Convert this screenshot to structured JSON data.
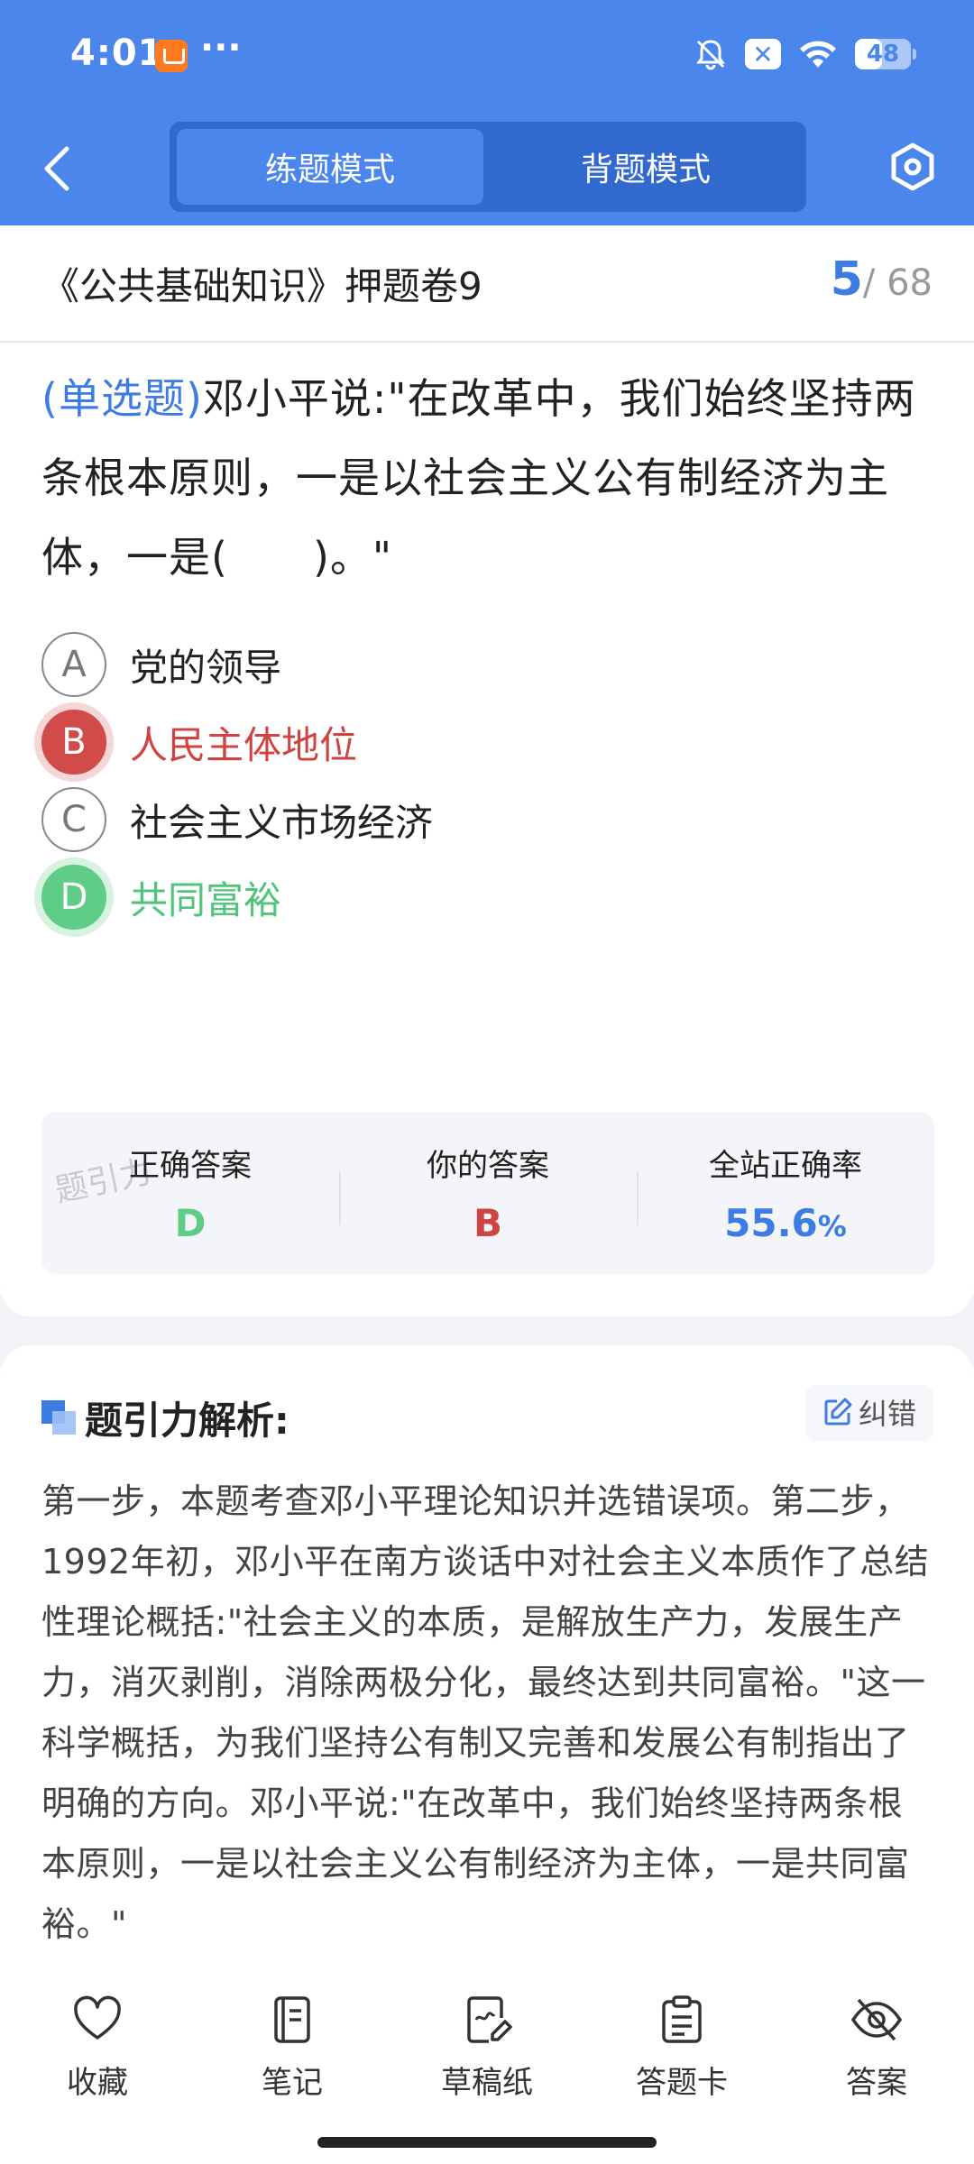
{
  "status_bar": {
    "time": "4:01",
    "more": "···",
    "battery": "48",
    "battery_level": 0.48
  },
  "nav": {
    "tabs": [
      {
        "label": "练题模式",
        "active": true
      },
      {
        "label": "背题模式",
        "active": false
      }
    ]
  },
  "paper": {
    "title": "《公共基础知识》押题卷9",
    "current": "5",
    "total": "/ 68"
  },
  "question": {
    "type": "(单选题)",
    "text": "邓小平说:\"在改革中，我们始终坚持两条根本原则，一是以社会主义公有制经济为主体，一是(　　)。\"",
    "options": [
      {
        "letter": "A",
        "text": "党的领导",
        "state": "normal"
      },
      {
        "letter": "B",
        "text": "人民主体地位",
        "state": "wrong"
      },
      {
        "letter": "C",
        "text": "社会主义市场经济",
        "state": "normal"
      },
      {
        "letter": "D",
        "text": "共同富裕",
        "state": "right"
      }
    ]
  },
  "stats": {
    "watermark": "题引力",
    "correct_label": "正确答案",
    "correct_value": "D",
    "yours_label": "你的答案",
    "yours_value": "B",
    "rate_label": "全站正确率",
    "rate_value": "55.6",
    "rate_unit": "%"
  },
  "analysis": {
    "title": "题引力解析:",
    "report_label": "纠错",
    "text": "第一步，本题考查邓小平理论知识并选错误项。第二步，1992年初，邓小平在南方谈话中对社会主义本质作了总结性理论概括:\"社会主义的本质，是解放生产力，发展生产力，消灭剥削，消除两极分化，最终达到共同富裕。\"这一科学概括，为我们坚持公有制又完善和发展公有制指出了明确的方向。邓小平说:\"在改革中，我们始终坚持两条根本原则，一是以社会主义公有制经济为主体，一是共同富裕。\""
  },
  "toolbar": {
    "items": [
      {
        "label": "收藏",
        "icon": "heart-icon"
      },
      {
        "label": "笔记",
        "icon": "notebook-icon"
      },
      {
        "label": "草稿纸",
        "icon": "draft-icon"
      },
      {
        "label": "答题卡",
        "icon": "clipboard-icon"
      },
      {
        "label": "答案",
        "icon": "eye-off-icon"
      }
    ]
  },
  "colors": {
    "primary": "#4a86ec",
    "correct": "#5fcd86",
    "wrong": "#cf4343"
  }
}
